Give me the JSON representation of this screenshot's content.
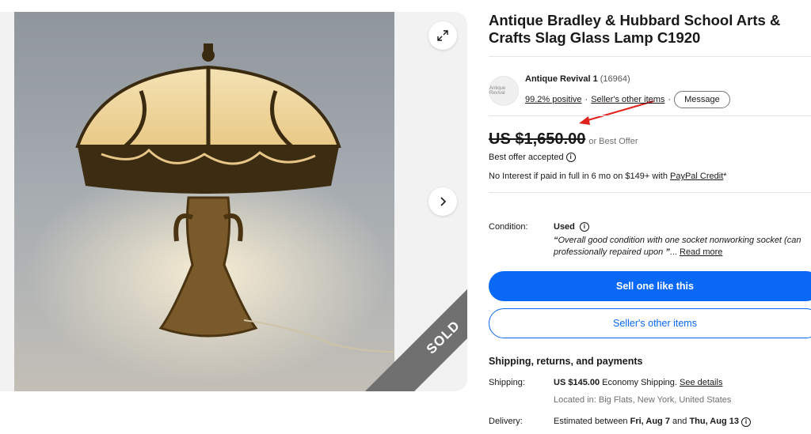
{
  "gallery": {
    "sold_label": "SOLD",
    "expand_icon": "expand-icon",
    "next_icon": "chevron-right-icon"
  },
  "listing": {
    "title": "Antique Bradley & Hubbard School Arts & Crafts Slag Glass Lamp C1920"
  },
  "seller": {
    "avatar_text": "Antique Revival",
    "name": "Antique Revival 1",
    "feedback_count": "(16964)",
    "positive": "99.2% positive",
    "other_items_link": "Seller's other items",
    "message_button": "Message"
  },
  "price": {
    "amount": "US $1,650.00",
    "or_best_offer": "or Best Offer",
    "best_offer_accepted": "Best offer accepted",
    "financing_text": "No Interest if paid in full in 6 mo on $149+ with",
    "financing_link": "PayPal Credit",
    "financing_suffix": "*"
  },
  "condition": {
    "label": "Condition:",
    "value": "Used",
    "quote_open": "“",
    "desc_line1": "Overall good condition with one socket nonworking socket (can",
    "desc_line2": "professionally repaired upon",
    "quote_close": "”",
    "ellipsis": "...",
    "read_more": "Read more"
  },
  "actions": {
    "sell_one": "Sell one like this",
    "seller_other_items": "Seller's other items"
  },
  "shipping": {
    "heading": "Shipping, returns, and payments",
    "shipping_label": "Shipping:",
    "shipping_price": "US $145.00",
    "shipping_method": "Economy Shipping.",
    "see_details": "See details",
    "location": "Located in: Big Flats, New York, United States",
    "delivery_label": "Delivery:",
    "delivery_prefix": "Estimated between",
    "delivery_start": "Fri, Aug 7",
    "delivery_and": "and",
    "delivery_end": "Thu, Aug 13"
  },
  "colors": {
    "primary_blue": "#0968f6",
    "annotation_red": "#e0201b",
    "sold_ribbon": "#707070"
  }
}
